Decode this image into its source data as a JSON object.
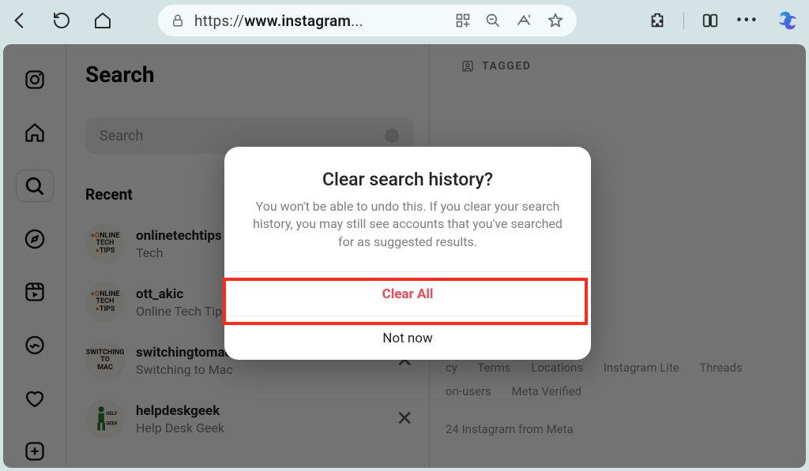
{
  "browser": {
    "url_prefix": "https://",
    "url_host": "www.instagram",
    "url_suffix": "..."
  },
  "sidebar": {
    "items": [
      "instagram-logo",
      "home",
      "search",
      "explore",
      "reels",
      "messages",
      "notifications",
      "create"
    ]
  },
  "search_panel": {
    "title": "Search",
    "placeholder": "Search",
    "recent_label": "Recent",
    "recent": [
      {
        "username": "onlinetechtips",
        "subtitle": "Tech",
        "avatar_style": "ott"
      },
      {
        "username": "ott_akic",
        "subtitle": "Online Tech Tips",
        "avatar_style": "ott"
      },
      {
        "username": "switchingtomac",
        "subtitle": "Switching to Mac",
        "avatar_style": "stm"
      },
      {
        "username": "helpdeskgeek",
        "subtitle": "Help Desk Geek",
        "avatar_style": "hdg"
      }
    ]
  },
  "rightcol": {
    "tagged_label": "TAGGED",
    "footer_links": [
      "cy",
      "Terms",
      "Locations",
      "Instagram Lite",
      "Threads",
      "on-users",
      "Meta Verified"
    ],
    "footer_meta": "24 Instagram from Meta"
  },
  "modal": {
    "title": "Clear search history?",
    "body": "You won't be able to undo this. If you clear your search history, you may still see accounts that you've searched for as suggested results.",
    "clear_label": "Clear All",
    "notnow_label": "Not now"
  }
}
